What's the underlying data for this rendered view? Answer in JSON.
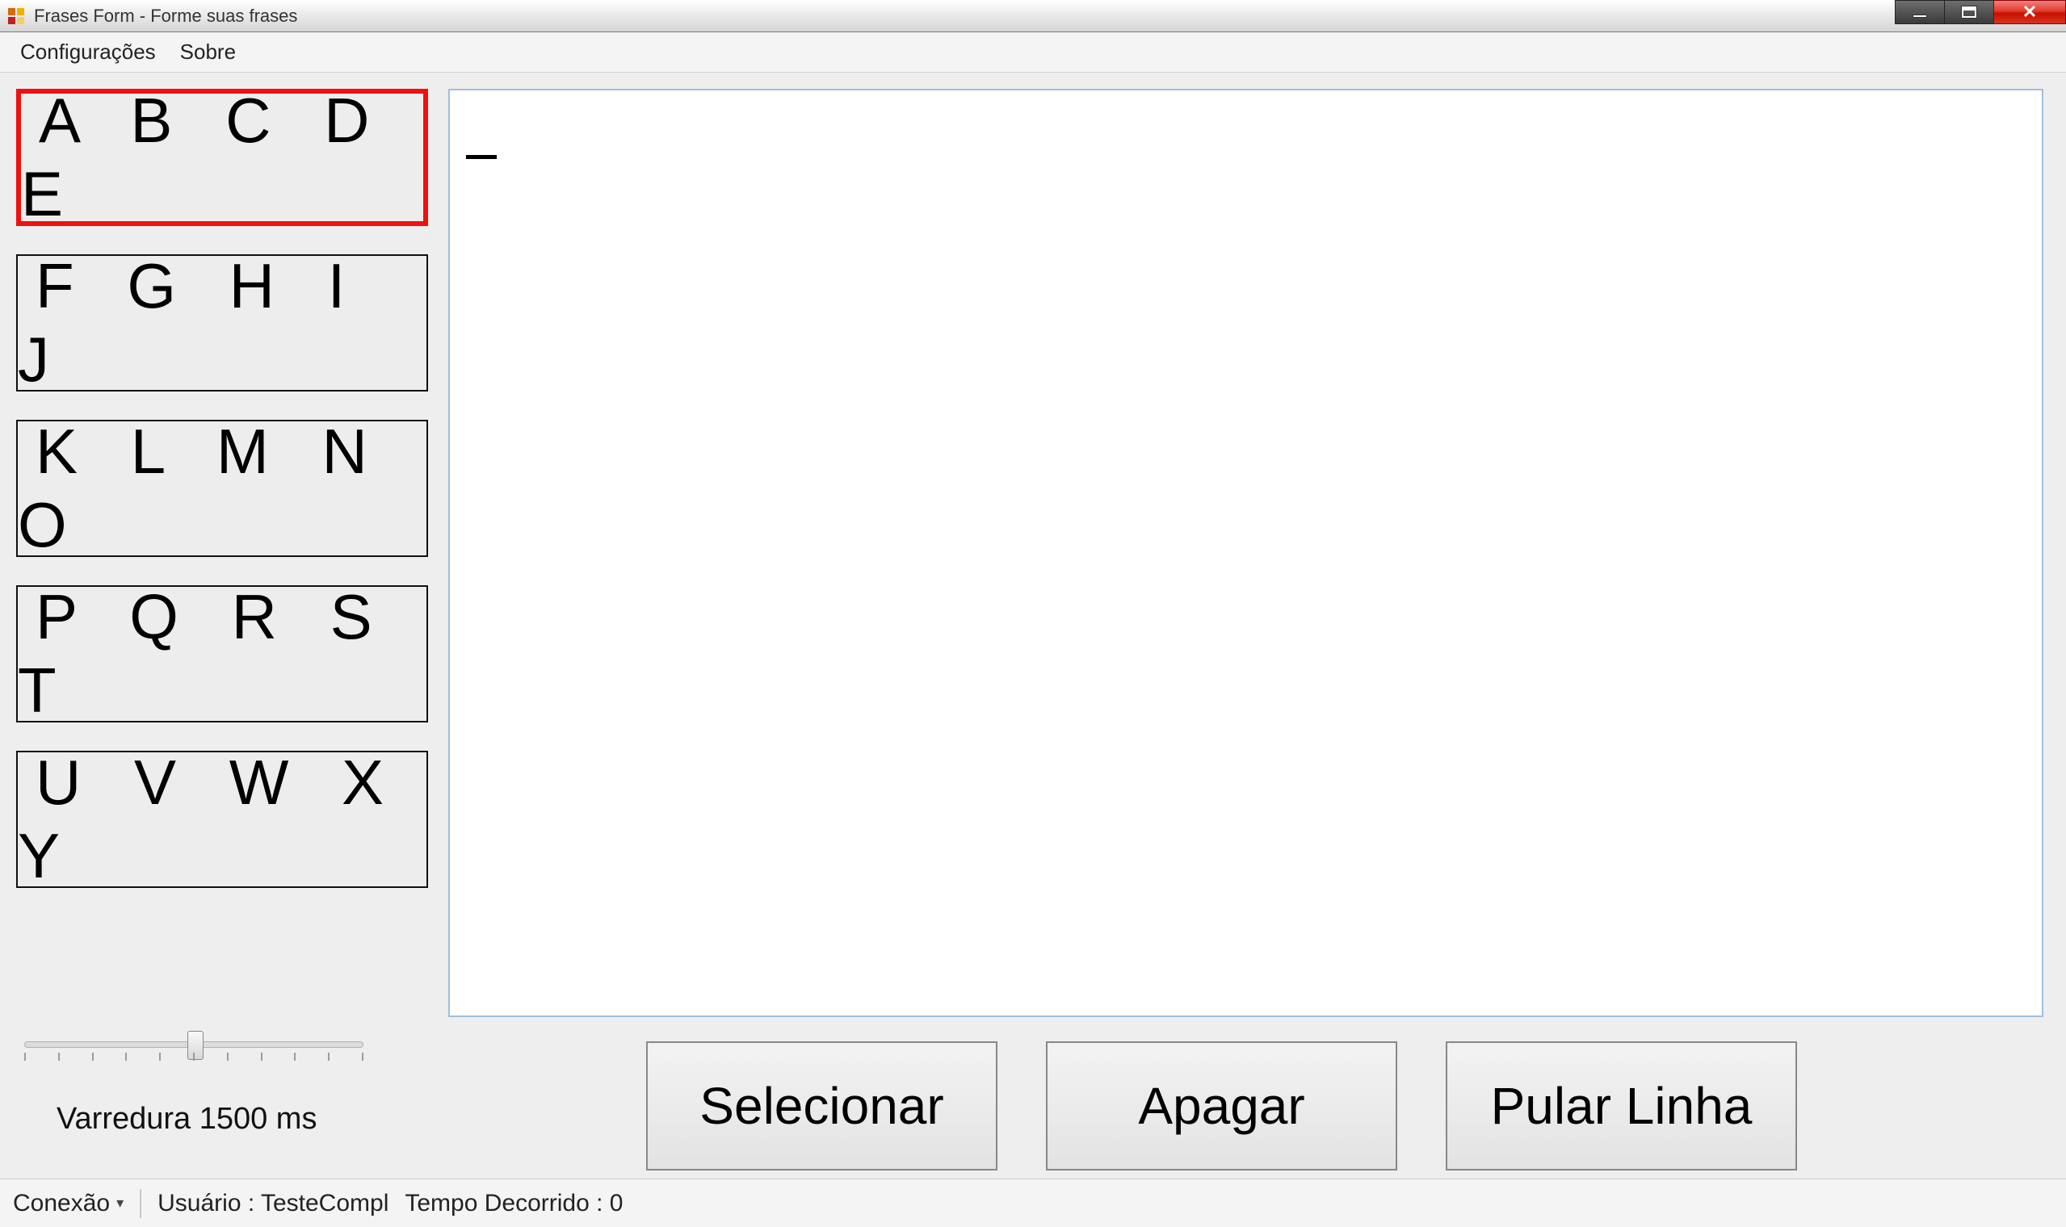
{
  "window": {
    "title": "Frases Form - Forme suas frases"
  },
  "menu": {
    "config": "Configurações",
    "about": "Sobre"
  },
  "letters": {
    "row0": "A B C D E",
    "row1": "F G H I J",
    "row2": "K L M N O",
    "row3": "P Q R S T",
    "row4": "U V W X Y"
  },
  "textarea": {
    "content": ""
  },
  "scan": {
    "label": "Varredura 1500 ms"
  },
  "actions": {
    "select": "Selecionar",
    "delete": "Apagar",
    "newline": "Pular Linha"
  },
  "status": {
    "connection": "Conexão",
    "user": "Usuário : TesteCompl",
    "elapsed": "Tempo Decorrido : 0"
  }
}
